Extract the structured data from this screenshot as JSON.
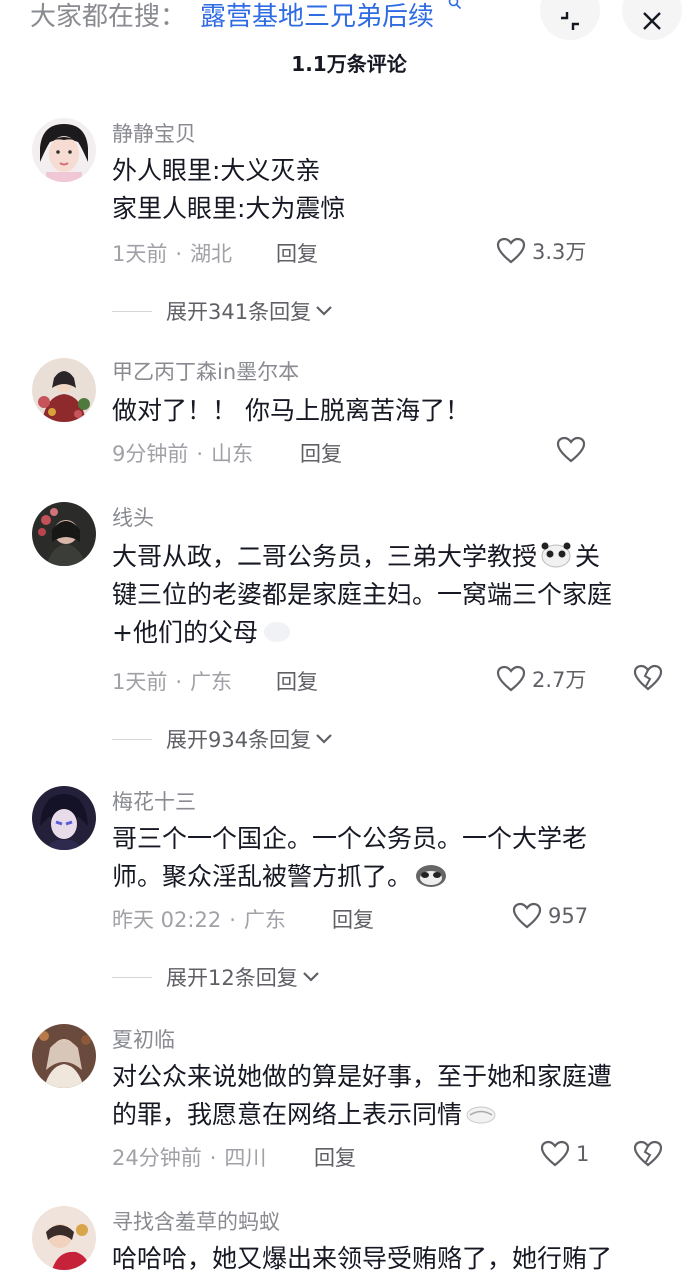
{
  "search": {
    "prefix": "大家都在搜：",
    "keyword": "露营基地三兄弟后续",
    "icon": "search-icon"
  },
  "header": {
    "title": "1.1万条评论"
  },
  "comments": [
    {
      "user": "静静宝贝",
      "text": [
        "外人眼里:大义灭亲",
        "家里人眼里:大为震惊"
      ],
      "time": "1天前",
      "location": "湖北",
      "reply_label": "回复",
      "likes": "3.3万",
      "expand": "展开341条回复"
    },
    {
      "user": "甲乙丙丁森in墨尔本",
      "text": [
        "做对了！！ 你马上脱离苦海了！"
      ],
      "time": "9分钟前",
      "location": "山东",
      "reply_label": "回复",
      "likes": ""
    },
    {
      "user": "线头",
      "text_a": "大哥从政，二哥公务员，三弟大学教授",
      "text_b": "关",
      "text_c": "键三位的老婆都是家庭主妇。一窝端三个家庭",
      "text_d": "+他们的父母",
      "time": "1天前",
      "location": "广东",
      "reply_label": "回复",
      "likes": "2.7万",
      "expand": "展开934条回复"
    },
    {
      "user": "梅花十三",
      "text_a": "哥三个一个国企。一个公务员。一个大学老",
      "text_b": "师。聚众淫乱被警方抓了。",
      "time": "昨天 02:22",
      "location": "广东",
      "reply_label": "回复",
      "likes": "957",
      "expand": "展开12条回复"
    },
    {
      "user": "夏初临",
      "text_a": "对公众来说她做的算是好事，至于她和家庭遭",
      "text_b": "的罪，我愿意在网络上表示同情",
      "time": "24分钟前",
      "location": "四川",
      "reply_label": "回复",
      "likes": "1"
    },
    {
      "user": "寻找含羞草的蚂蚁",
      "text_a": "哈哈哈，她又爆出来领导受贿赂了，她行贿了"
    }
  ],
  "colors": {
    "keyword": "#2f6ce4",
    "muted": "#8a8b91",
    "text": "#161823"
  }
}
